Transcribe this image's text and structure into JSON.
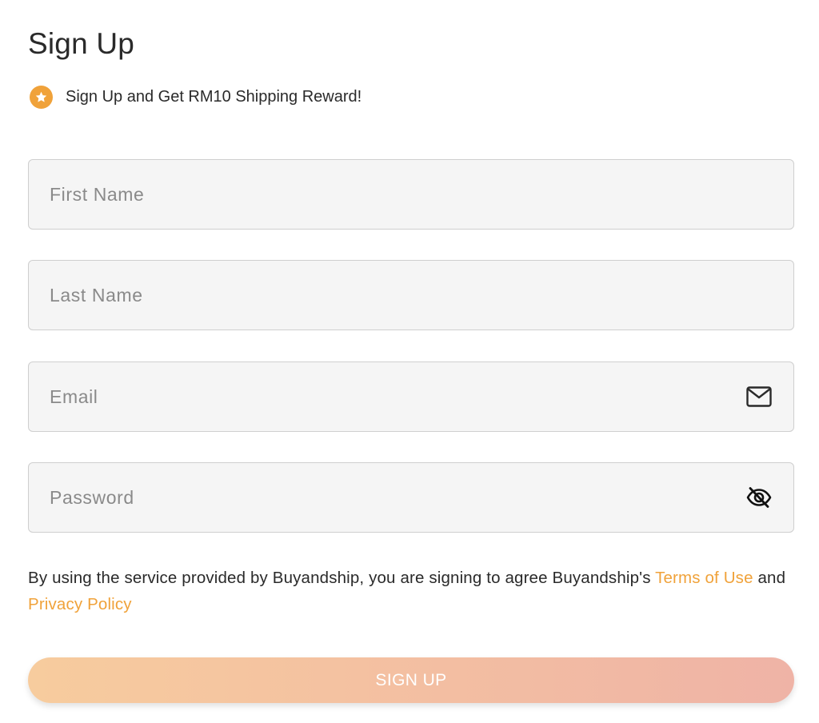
{
  "form": {
    "title": "Sign Up",
    "reward": {
      "icon": "star-badge-icon",
      "text": "Sign Up and Get RM10 Shipping Reward!"
    },
    "fields": {
      "first_name": {
        "placeholder": "First Name",
        "value": ""
      },
      "last_name": {
        "placeholder": "Last Name",
        "value": ""
      },
      "email": {
        "placeholder": "Email",
        "value": "",
        "icon": "envelope-icon"
      },
      "password": {
        "placeholder": "Password",
        "value": "",
        "icon": "eye-slash-icon"
      }
    },
    "terms": {
      "prefix": "By using the service provided by Buyandship, you are signing to agree Buyandship's ",
      "terms_link": "Terms of Use",
      "conjunction": " and ",
      "privacy_link": "Privacy Policy"
    },
    "submit_label": "SIGN UP"
  },
  "colors": {
    "accent": "#f0a23a",
    "field_bg": "#f5f5f5",
    "field_border": "#cfcfcf",
    "button_gradient_start": "#f7cc9e",
    "button_gradient_end": "#efb3a6"
  }
}
